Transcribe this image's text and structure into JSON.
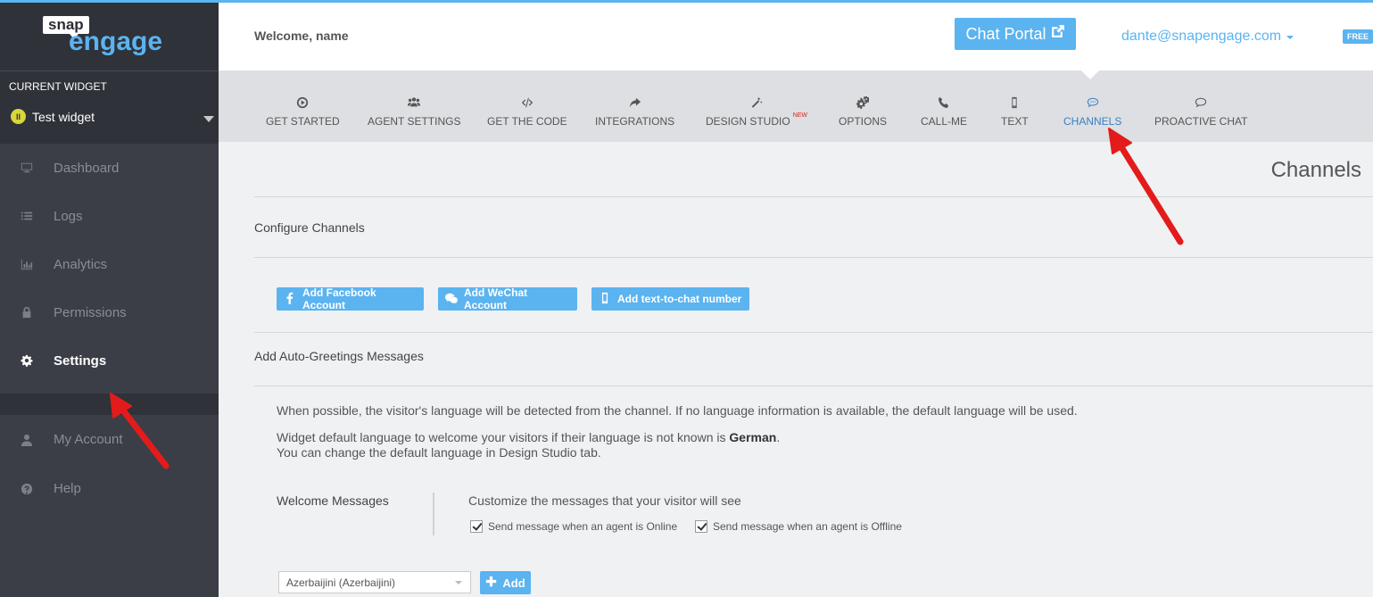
{
  "logo": {
    "snap": "snap",
    "engage": "engage"
  },
  "sidebar": {
    "current_widget_label": "CURRENT WIDGET",
    "widget_status": "II",
    "widget_name": "Test widget",
    "items": [
      {
        "label": "Dashboard",
        "icon": "monitor-icon"
      },
      {
        "label": "Logs",
        "icon": "list-icon"
      },
      {
        "label": "Analytics",
        "icon": "bar-chart-icon"
      },
      {
        "label": "Permissions",
        "icon": "lock-icon"
      },
      {
        "label": "Settings",
        "icon": "gear-icon",
        "active": true
      }
    ],
    "account_items": [
      {
        "label": "My Account",
        "icon": "user-icon"
      },
      {
        "label": "Help",
        "icon": "help-icon"
      }
    ]
  },
  "header": {
    "welcome": "Welcome, name",
    "chat_portal": "Chat Portal",
    "email": "dante@snapengage.com",
    "plan_badge": "FREE"
  },
  "tabs": [
    {
      "label": "GET STARTED",
      "icon": "play-circle-icon"
    },
    {
      "label": "AGENT SETTINGS",
      "icon": "users-icon"
    },
    {
      "label": "GET THE CODE",
      "icon": "code-icon"
    },
    {
      "label": "INTEGRATIONS",
      "icon": "share-arrow-icon"
    },
    {
      "label": "DESIGN STUDIO",
      "icon": "magic-wand-icon",
      "badge": "NEW"
    },
    {
      "label": "OPTIONS",
      "icon": "cogs-icon"
    },
    {
      "label": "CALL-ME",
      "icon": "phone-icon"
    },
    {
      "label": "TEXT",
      "icon": "mobile-icon"
    },
    {
      "label": "CHANNELS",
      "icon": "chat-bubble-dots-icon",
      "active": true
    },
    {
      "label": "PROACTIVE CHAT",
      "icon": "chat-bubble-icon"
    }
  ],
  "content": {
    "page_title": "Channels",
    "configure_title": "Configure Channels",
    "buttons": {
      "facebook": "Add Facebook Account",
      "wechat": "Add WeChat Account",
      "text_to_chat": "Add text-to-chat number"
    },
    "auto_greetings_title": "Add Auto-Greetings Messages",
    "info_line1": "When possible, the visitor's language will be detected from the channel. If no language information is available, the default language will be used.",
    "info_line2_prefix": "Widget default language to welcome your visitors if their language is not known is ",
    "info_line2_lang": "German",
    "info_line2_suffix": ".",
    "info_line3": "You can change the default language in Design Studio tab.",
    "welcome_messages_label": "Welcome Messages",
    "welcome_messages_desc": "Customize the messages that your visitor will see",
    "checkbox_online": "Send message when an agent is Online",
    "checkbox_offline": "Send message when an agent is Offline",
    "checkbox_online_checked": true,
    "checkbox_offline_checked": true,
    "language_select": "Azerbaijini (Azerbaijini)",
    "add_button": "Add"
  },
  "colors": {
    "accent": "#5bb3f0",
    "sidebar_bg": "#3b3e46",
    "annotation_arrow": "#e31b1b"
  }
}
